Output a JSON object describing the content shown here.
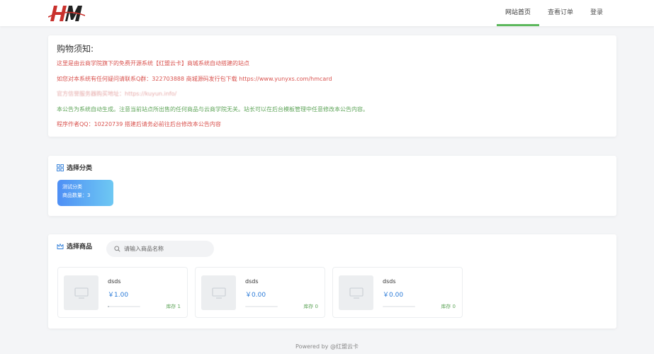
{
  "nav": {
    "items": [
      {
        "label": "网站首页",
        "active": true
      },
      {
        "label": "查看订单",
        "active": false
      },
      {
        "label": "登录",
        "active": false
      }
    ]
  },
  "notice": {
    "title": "购物须知:",
    "lines": [
      {
        "text": "这里是由云商学院旗下的免费开源系统【红盟云卡】商城系统自动搭建的站点",
        "style": "red"
      },
      {
        "text": "如您对本系统有任何疑问请联系Q群：322703888  商城源码发行包下载 https://www.yunyxs.com/hmcard",
        "style": "red"
      },
      {
        "text": "官方信誉服务器购买地址：https://kuyun.info/",
        "style": "red-faint"
      },
      {
        "text": "本公告为系统自动生成。注意当前站点所出售的任何商品与云商学院无关。站长可以在后台模板管理中任意修改本公告内容。",
        "style": "green"
      },
      {
        "text": "程序作者QQ：10220739   搭建后请务必前往后台修改本公告内容",
        "style": "red"
      }
    ]
  },
  "category": {
    "title": "选择分类",
    "items": [
      {
        "name": "测试分类",
        "count_label": "商品数量：3"
      }
    ]
  },
  "products": {
    "title": "选择商品",
    "search_placeholder": "请输入商品名称",
    "items": [
      {
        "name": "dsds",
        "price": "￥1.00",
        "stock": "库存 1",
        "stock_fraction": 0.05
      },
      {
        "name": "dsds",
        "price": "￥0.00",
        "stock": "库存 0",
        "stock_fraction": 0
      },
      {
        "name": "dsds",
        "price": "￥0.00",
        "stock": "库存 0",
        "stock_fraction": 0
      }
    ]
  },
  "footer": "Powered by @红盟云卡",
  "colors": {
    "accent_green": "#5cb85c",
    "notice_red": "#d9534f",
    "notice_green": "#5fa55a",
    "price_blue": "#2b7bd8",
    "category_gradient_start": "#4e8ff5",
    "category_gradient_end": "#6ec8f3"
  },
  "icons": {
    "logo": "hm-logo",
    "category": "grid-icon",
    "products": "crown-icon",
    "search": "search-icon",
    "product_image": "monitor-icon"
  }
}
